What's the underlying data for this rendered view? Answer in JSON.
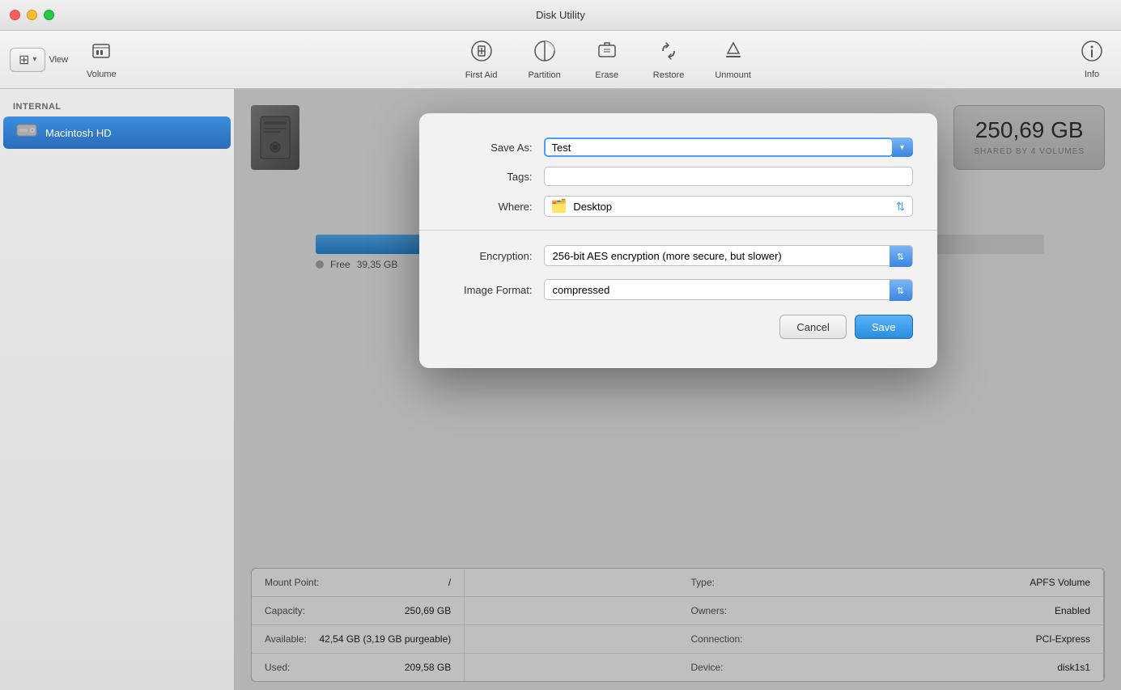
{
  "window": {
    "title": "Disk Utility"
  },
  "toolbar": {
    "view_label": "View",
    "volume_label": "Volume",
    "firstaid_label": "First Aid",
    "partition_label": "Partition",
    "erase_label": "Erase",
    "restore_label": "Restore",
    "unmount_label": "Unmount",
    "info_label": "Info"
  },
  "sidebar": {
    "section_label": "Internal",
    "items": [
      {
        "label": "Macintosh HD",
        "selected": true
      }
    ]
  },
  "disk_info": {
    "size": "250,69 GB",
    "shared_by": "SHARED BY 4 VOLUMES",
    "free_label": "Free",
    "free_size": "39,35 GB"
  },
  "info_table": {
    "rows": [
      {
        "label1": "Mount Point:",
        "value1": "/",
        "label2": "Type:",
        "value2": "APFS Volume"
      },
      {
        "label1": "Capacity:",
        "value1": "250,69 GB",
        "label2": "Owners:",
        "value2": "Enabled"
      },
      {
        "label1": "Available:",
        "value1": "42,54 GB (3,19 GB purgeable)",
        "label2": "Connection:",
        "value2": "PCI-Express"
      },
      {
        "label1": "Used:",
        "value1": "209,58 GB",
        "label2": "Device:",
        "value2": "disk1s1"
      }
    ]
  },
  "dialog": {
    "save_as_label": "Save As:",
    "save_as_value": "Test",
    "tags_label": "Tags:",
    "tags_value": "",
    "where_label": "Where:",
    "where_value": "Desktop",
    "encryption_label": "Encryption:",
    "encryption_value": "256-bit AES encryption (more secure, but slower)",
    "image_format_label": "Image Format:",
    "image_format_value": "compressed",
    "cancel_label": "Cancel",
    "save_label": "Save"
  }
}
